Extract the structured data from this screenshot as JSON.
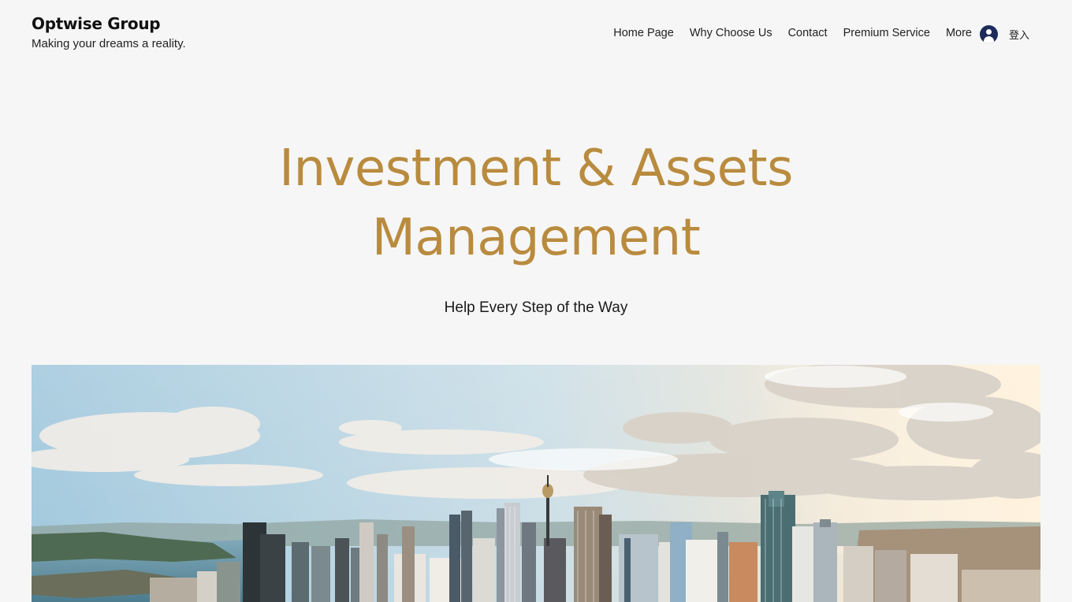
{
  "header": {
    "brand_name": "Optwise Group",
    "tagline": "Making your dreams a reality."
  },
  "nav": {
    "items": [
      {
        "label": "Home Page"
      },
      {
        "label": "Why Choose Us"
      },
      {
        "label": "Contact"
      },
      {
        "label": "Premium Service"
      },
      {
        "label": "More"
      }
    ],
    "login_label": "登入",
    "login_icon": "user-avatar-icon"
  },
  "hero": {
    "title_line1": "Investment & Assets",
    "title_line2": "Management",
    "subtitle": "Help Every Step of the Way",
    "image": "city-skyline-aerial-photo"
  },
  "colors": {
    "background": "#f6f6f6",
    "accent_gold": "#b98b3e",
    "avatar_navy": "#1c2b5a"
  }
}
